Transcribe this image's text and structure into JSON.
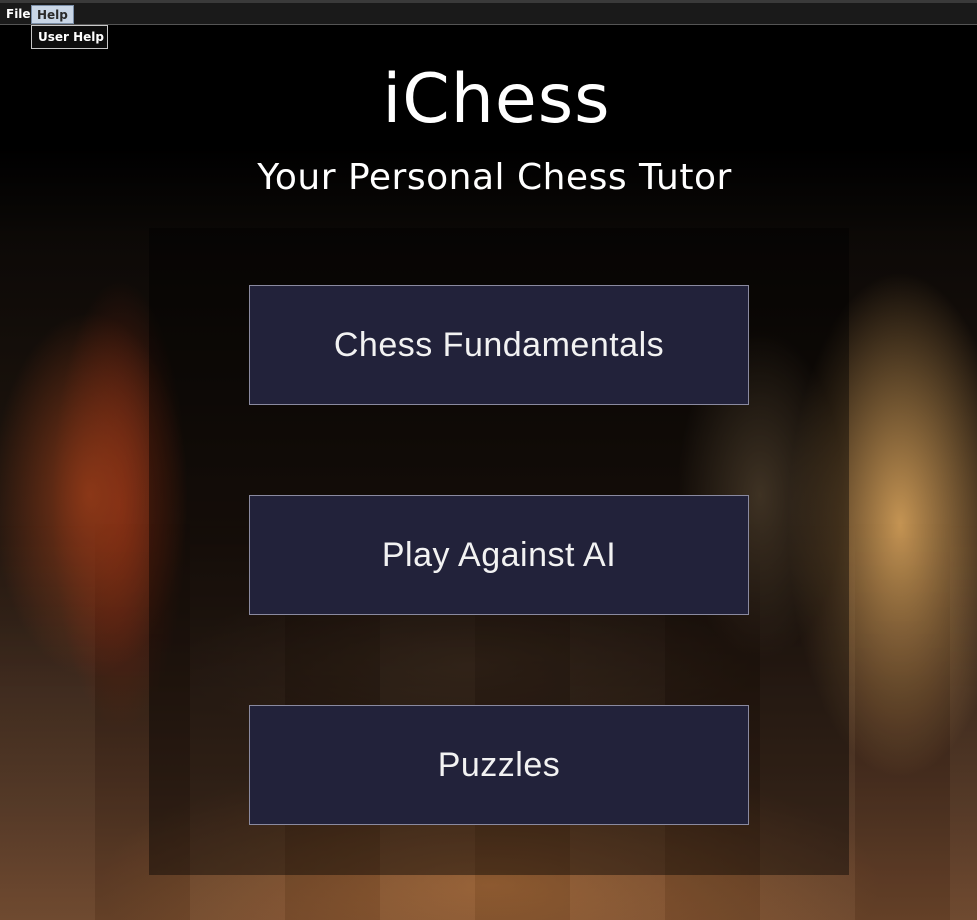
{
  "menubar": {
    "items": [
      {
        "label": "File"
      },
      {
        "label": "Help"
      }
    ],
    "help_dropdown": {
      "items": [
        {
          "label": "User Help"
        }
      ]
    }
  },
  "header": {
    "title": "iChess",
    "subtitle": "Your Personal Chess Tutor"
  },
  "menu_buttons": [
    {
      "label": "Chess Fundamentals"
    },
    {
      "label": "Play Against AI"
    },
    {
      "label": "Puzzles"
    }
  ],
  "colors": {
    "button_background": "#22223a",
    "button_border": "#8a8aa0",
    "text": "#ffffff",
    "menu_highlight": "#c9d6e6"
  }
}
